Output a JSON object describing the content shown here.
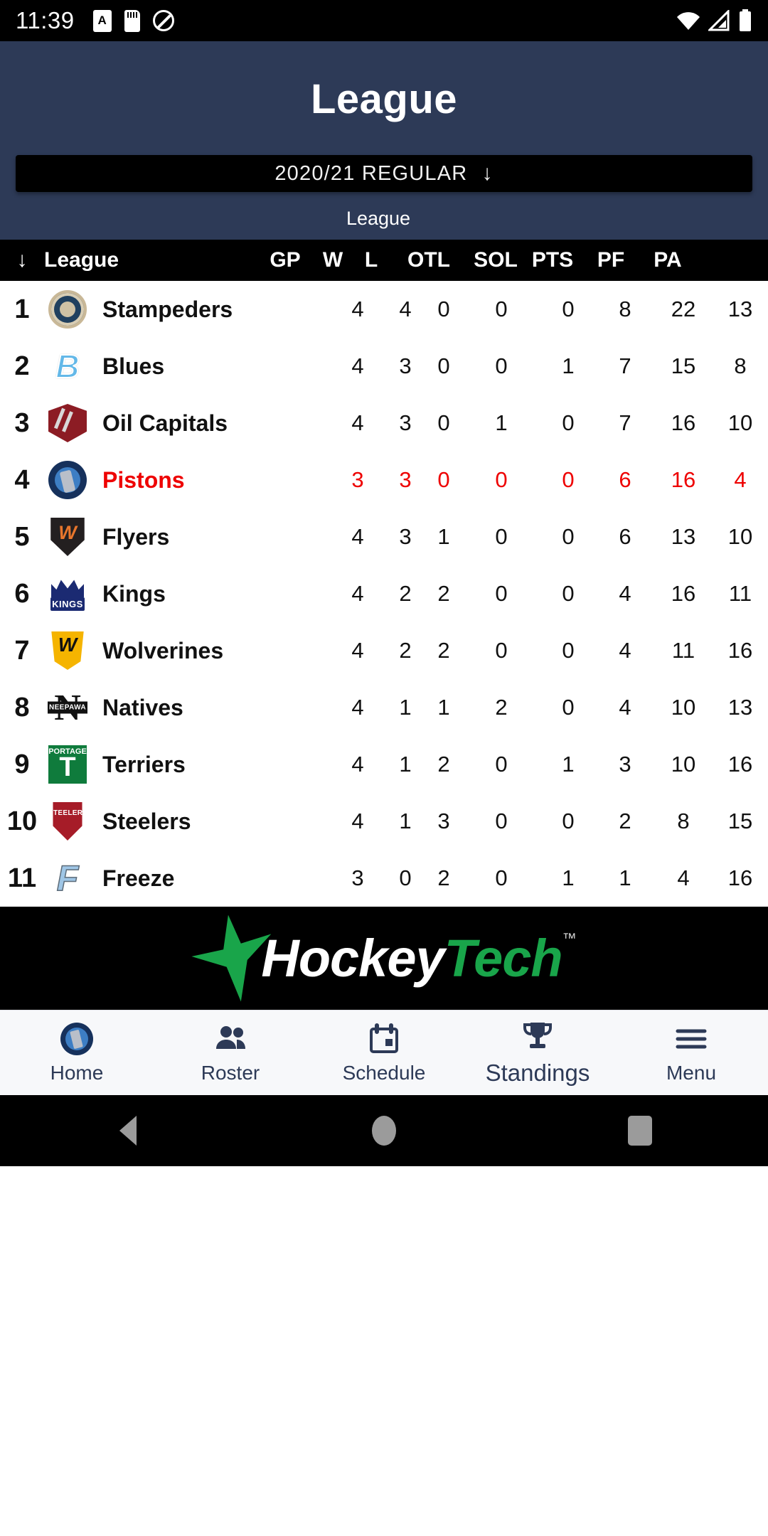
{
  "status_bar": {
    "time": "11:39",
    "icons_left": [
      "alarm-a-icon",
      "sd-card-icon",
      "do-not-disturb-icon"
    ],
    "icons_right": [
      "wifi-icon",
      "cellular-signal-icon",
      "battery-icon"
    ]
  },
  "header": {
    "title": "League",
    "season_selector": {
      "value": "2020/21 REGULAR",
      "caret": "↓"
    },
    "group_label": "League"
  },
  "table": {
    "sort_icon": "↓",
    "columns": [
      "League",
      "GP",
      "W",
      "L",
      "OTL",
      "SOL",
      "PTS",
      "PF",
      "PA"
    ],
    "rows": [
      {
        "rank": "1",
        "team": "Stampeders",
        "logo": "lg-stampeders",
        "gp": "4",
        "w": "4",
        "l": "0",
        "otl": "0",
        "sol": "0",
        "pts": "8",
        "pf": "22",
        "pa": "13",
        "highlight": false
      },
      {
        "rank": "2",
        "team": "Blues",
        "logo": "lg-blues",
        "gp": "4",
        "w": "3",
        "l": "0",
        "otl": "0",
        "sol": "1",
        "pts": "7",
        "pf": "15",
        "pa": "8",
        "highlight": false
      },
      {
        "rank": "3",
        "team": "Oil Capitals",
        "logo": "lg-oilcap",
        "gp": "4",
        "w": "3",
        "l": "0",
        "otl": "1",
        "sol": "0",
        "pts": "7",
        "pf": "16",
        "pa": "10",
        "highlight": false
      },
      {
        "rank": "4",
        "team": "Pistons",
        "logo": "lg-pistons",
        "gp": "3",
        "w": "3",
        "l": "0",
        "otl": "0",
        "sol": "0",
        "pts": "6",
        "pf": "16",
        "pa": "4",
        "highlight": true
      },
      {
        "rank": "5",
        "team": "Flyers",
        "logo": "lg-flyers",
        "gp": "4",
        "w": "3",
        "l": "1",
        "otl": "0",
        "sol": "0",
        "pts": "6",
        "pf": "13",
        "pa": "10",
        "highlight": false
      },
      {
        "rank": "6",
        "team": "Kings",
        "logo": "lg-kings",
        "gp": "4",
        "w": "2",
        "l": "2",
        "otl": "0",
        "sol": "0",
        "pts": "4",
        "pf": "16",
        "pa": "11",
        "highlight": false
      },
      {
        "rank": "7",
        "team": "Wolverines",
        "logo": "lg-wolverines",
        "gp": "4",
        "w": "2",
        "l": "2",
        "otl": "0",
        "sol": "0",
        "pts": "4",
        "pf": "11",
        "pa": "16",
        "highlight": false
      },
      {
        "rank": "8",
        "team": "Natives",
        "logo": "lg-natives",
        "gp": "4",
        "w": "1",
        "l": "1",
        "otl": "2",
        "sol": "0",
        "pts": "4",
        "pf": "10",
        "pa": "13",
        "highlight": false
      },
      {
        "rank": "9",
        "team": "Terriers",
        "logo": "lg-terriers",
        "gp": "4",
        "w": "1",
        "l": "2",
        "otl": "0",
        "sol": "1",
        "pts": "3",
        "pf": "10",
        "pa": "16",
        "highlight": false
      },
      {
        "rank": "10",
        "team": "Steelers",
        "logo": "lg-steelers",
        "gp": "4",
        "w": "1",
        "l": "3",
        "otl": "0",
        "sol": "0",
        "pts": "2",
        "pf": "8",
        "pa": "15",
        "highlight": false
      },
      {
        "rank": "11",
        "team": "Freeze",
        "logo": "lg-freeze",
        "gp": "3",
        "w": "0",
        "l": "2",
        "otl": "0",
        "sol": "1",
        "pts": "1",
        "pf": "4",
        "pa": "16",
        "highlight": false
      }
    ]
  },
  "ad_banner": {
    "text_white": "Hockey",
    "text_green": "Tech",
    "trademark": "™",
    "icon": "star-icon"
  },
  "bottom_nav": {
    "items": [
      {
        "label": "Home",
        "icon": "pistons-logo-icon",
        "active": false
      },
      {
        "label": "Roster",
        "icon": "people-icon",
        "active": false
      },
      {
        "label": "Schedule",
        "icon": "calendar-icon",
        "active": false
      },
      {
        "label": "Standings",
        "icon": "trophy-icon",
        "active": true
      },
      {
        "label": "Menu",
        "icon": "hamburger-icon",
        "active": false
      }
    ]
  },
  "android_nav": {
    "back": "back-icon",
    "home": "home-icon",
    "recents": "recents-icon"
  },
  "colors": {
    "header_navy": "#2d3a57",
    "highlight_red": "#ee0000",
    "accent_green": "#19a54a",
    "black": "#000000"
  }
}
